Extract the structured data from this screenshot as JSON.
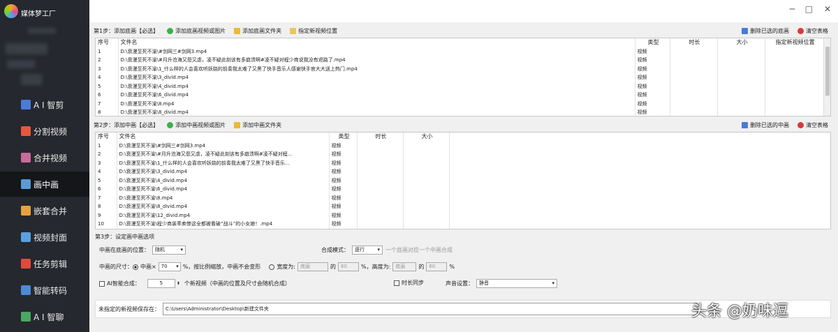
{
  "app": {
    "title": "媒体梦工厂"
  },
  "nav": [
    {
      "label": "A I 智剪",
      "color": "#4a7bd8"
    },
    {
      "label": "分割视频",
      "color": "#e8563c"
    },
    {
      "label": "合并视频",
      "color": "#c76b9a"
    },
    {
      "label": "画中画",
      "color": "#5b9bd5",
      "active": true
    },
    {
      "label": "嵌套合并",
      "color": "#e8a23c"
    },
    {
      "label": "视频封面",
      "color": "#5aa0e0"
    },
    {
      "label": "任务剪辑",
      "color": "#e04a3c"
    },
    {
      "label": "智能转码",
      "color": "#4a8bd8"
    },
    {
      "label": "A I 智聊",
      "color": "#4aa860"
    }
  ],
  "step1": {
    "label": "第1步：添加底画【必选】",
    "add_video": "添加底画视频或图片",
    "add_folder": "添加底画文件夹",
    "set_position": "指定新视频位置",
    "delete_selected": "删除已选的底画",
    "clear_table": "清空表格",
    "headers": [
      "序号",
      "文件名",
      "类型",
      "时长",
      "大小",
      "指定新视频位置"
    ],
    "rows": [
      [
        "1",
        "D:\\衰漫至死不渝\\#剑网三#剑网3.mp4",
        "视频"
      ],
      [
        "2",
        "D:\\衰漫至死不渝\\#月升沧海又怨又虐，凌不疑此刻该有多崩溃啊#凌不疑对程少商说我没有退路了.mp4",
        "视频"
      ],
      [
        "3",
        "D:\\衰漫至死不渝\\1_什么样的人会喜欢听妖娆的前奏我太难了又黑了快手音乐人感谢快手官大大送上热门.mp4",
        "视频"
      ],
      [
        "4",
        "D:\\衰漫至死不渝\\3_divid.mp4",
        "视频"
      ],
      [
        "5",
        "D:\\衰漫至死不渝\\4_divid.mp4",
        "视频"
      ],
      [
        "6",
        "D:\\衰漫至死不渝\\6_divid.mp4",
        "视频"
      ],
      [
        "7",
        "D:\\衰漫至死不渝\\8.mp4",
        "视频"
      ],
      [
        "8",
        "D:\\衰漫至死不渝\\8_divid.mp4",
        "视频"
      ]
    ]
  },
  "step2": {
    "label": "第2步：添加中画【必选】",
    "add_video": "添加中画视频或图片",
    "add_folder": "添加中画文件夹",
    "delete_selected": "删除已选的中画",
    "clear_table": "清空表格",
    "headers": [
      "序号",
      "文件名",
      "类型",
      "时长",
      "大小"
    ],
    "rows": [
      [
        "1",
        "D:\\衰漫至死不渝\\#剑网三#剑网3.mp4",
        "视频"
      ],
      [
        "2",
        "D:\\衰漫至死不渝\\#月升沧海又怨又虐，凌不疑此刻该有多崩溃啊#凌不疑对程...",
        "视频"
      ],
      [
        "3",
        "D:\\衰漫至死不渝\\1_什么样的人会喜欢听妖娆的前奏我太难了又黑了快手音乐...",
        "视频"
      ],
      [
        "4",
        "D:\\衰漫至死不渝\\3_divid.mp4",
        "视频"
      ],
      [
        "5",
        "D:\\衰漫至死不渝\\4_divid.mp4",
        "视频"
      ],
      [
        "6",
        "D:\\衰漫至死不渝\\6_divid.mp4",
        "视频"
      ],
      [
        "7",
        "D:\\衰漫至死不渝\\8.mp4",
        "视频"
      ],
      [
        "8",
        "D:\\衰漫至死不渝\\8_divid.mp4",
        "视频"
      ],
      [
        "9",
        "D:\\衰漫至死不渝\\12_divid.mp4",
        "视频"
      ],
      [
        "10",
        "D:\\衰漫至死不渝\\程少商装乖卖惨这全都被看破“战斗”的小女娘！.mp4",
        "视频"
      ]
    ]
  },
  "step3": {
    "label": "第3步：设定画中画选项",
    "position_label": "中画在底画的位置：",
    "position_value": "随机",
    "mode_label": "合成模式：",
    "mode_value": "逐行",
    "mode_hint": "一个底画对应一个中画合成",
    "size_label": "中画的尺寸：",
    "scale_label": "中画×",
    "scale_value": "70",
    "scale_suffix": "%，按比例缩放，中画不会变形",
    "width_label": "宽度为:",
    "width_base": "底画",
    "of1": "的",
    "width_pct": "60",
    "height_label": "%，高度为:",
    "height_base": "底画",
    "of2": "的",
    "height_pct": "60",
    "pct": "%",
    "ai_label": "AI智能合成：",
    "ai_count": "5",
    "ai_suffix": "个新视频（中画的位置及尺寸会随机合成）",
    "sync_label": "时长同步",
    "audio_label": "声音设置：",
    "audio_value": "静音"
  },
  "save": {
    "label": "未指定的新视频保存在：",
    "path": "C:\\Users\\Administrator\\Desktop\\新建文件夹"
  },
  "watermark": "头条 @奶味逗"
}
